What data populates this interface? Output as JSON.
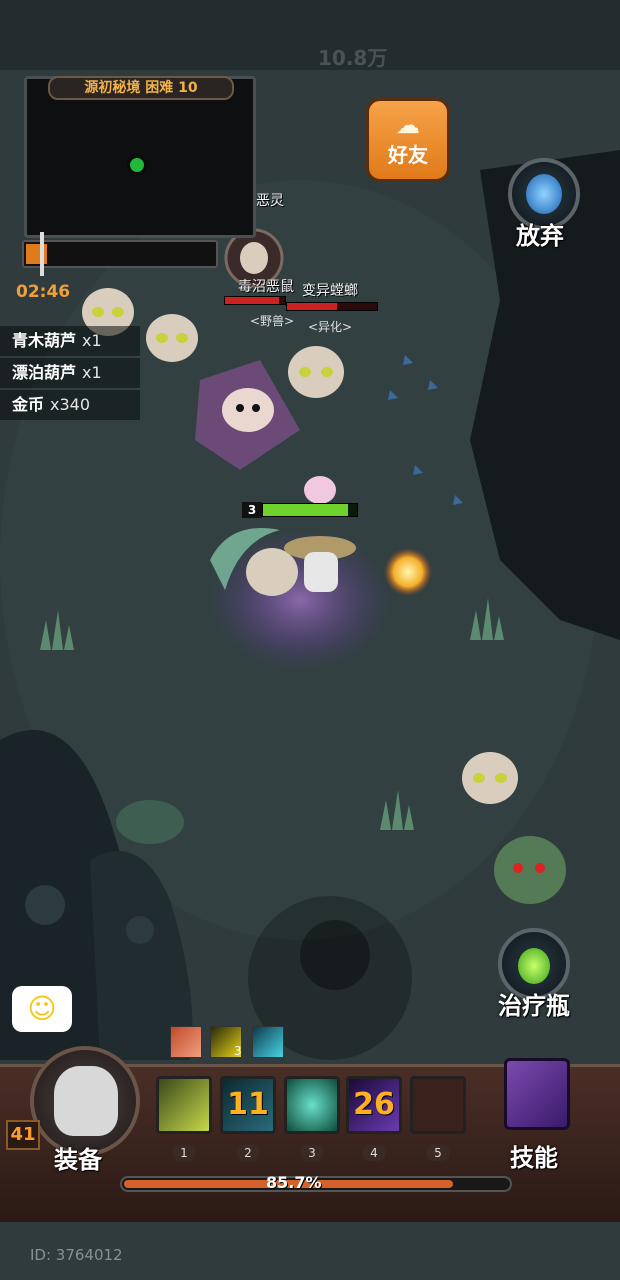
{
  "hud": {
    "damage_total": "10.8万",
    "dungeon_title": "源初秘境 困难 10",
    "timer": "02:46",
    "stage_progress": 0.11
  },
  "loot": [
    {
      "name": "青木葫芦",
      "count": "x1"
    },
    {
      "name": "漂泊葫芦",
      "count": "x1"
    },
    {
      "name": "金币",
      "count": "x340"
    }
  ],
  "buttons": {
    "friends": "好友",
    "abandon": "放弃",
    "heal_potion": "治疗瓶",
    "skills": "技能",
    "equip": "装备"
  },
  "enemies": [
    {
      "name": "恶灵"
    },
    {
      "name": "毒沼恶鼠",
      "tag": "<野兽>",
      "hp": 0.9
    },
    {
      "name": "变异螳螂",
      "tag": "<异化>",
      "hp": 0.55
    }
  ],
  "player": {
    "level": "3",
    "hp": 0.9,
    "character_level": "41"
  },
  "buffs": {
    "stack_count": "3"
  },
  "skill_slots": [
    {
      "number": "1",
      "cooldown": "",
      "icon": "wind-slash-icon"
    },
    {
      "number": "2",
      "cooldown": "11",
      "icon": "blade-icon"
    },
    {
      "number": "3",
      "cooldown": "",
      "icon": "vortex-icon"
    },
    {
      "number": "4",
      "cooldown": "26",
      "icon": "void-icon"
    },
    {
      "number": "5",
      "cooldown": "",
      "icon": "empty-slot-icon"
    }
  ],
  "experience": {
    "percent_label": "85.7%",
    "fraction": 0.857
  },
  "footer": {
    "player_id": "ID: 3764012"
  }
}
